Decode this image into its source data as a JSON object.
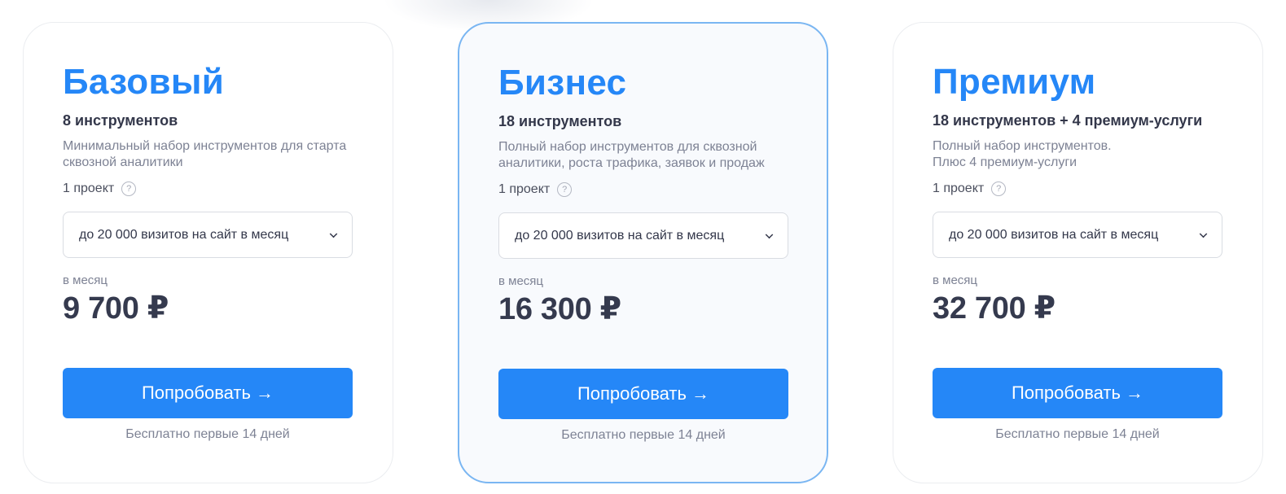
{
  "plans": [
    {
      "name": "Базовый",
      "tools": "8 инструментов",
      "description": [
        "Минимальный набор инструментов для старта",
        "сквозной аналитики"
      ],
      "projects": "1 проект",
      "help_icon": "?",
      "visits_select": "до 20 000 визитов на сайт в месяц",
      "period": "в месяц",
      "price": "9 700 ₽",
      "button": "Попробовать →",
      "free_note": "Бесплатно первые 14 дней"
    },
    {
      "name": "Бизнес",
      "tools": "18 инструментов",
      "description": [
        "Полный набор инструментов для сквозной",
        "аналитики, роста трафика, заявок и продаж"
      ],
      "projects": "1 проект",
      "help_icon": "?",
      "visits_select": "до 20 000 визитов на сайт в месяц",
      "period": "в месяц",
      "price": "16 300 ₽",
      "button": "Попробовать →",
      "free_note": "Бесплатно первые 14 дней"
    },
    {
      "name": "Премиум",
      "tools": "18 инструментов + 4 премиум-услуги",
      "description": [
        "Полный набор инструментов.",
        "Плюс 4 премиум-услуги"
      ],
      "projects": "1 проект",
      "help_icon": "?",
      "visits_select": "до 20 000 визитов на сайт в месяц",
      "period": "в месяц",
      "price": "32 700 ₽",
      "button": "Попробовать →",
      "free_note": "Бесплатно первые 14 дней"
    }
  ],
  "colors": {
    "accent": "#2587f7",
    "featured_border": "#7ab6f2",
    "price_text": "#353a4e"
  },
  "icons": {
    "help": "question-circle-icon",
    "select": "chevron-down-icon",
    "button": "arrow-right-icon"
  }
}
